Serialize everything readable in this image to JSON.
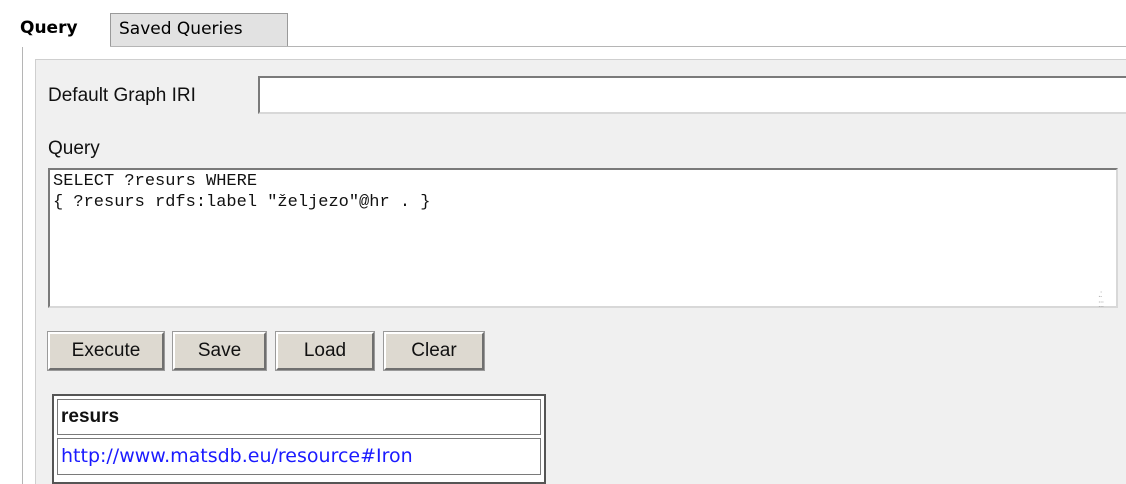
{
  "tabs": {
    "query_label": "Query",
    "saved_label": "Saved Queries"
  },
  "form": {
    "graph_label": "Default Graph IRI",
    "graph_value": "",
    "query_label": "Query",
    "query_text": "SELECT ?resurs WHERE\n{ ?resurs rdfs:label \"željezo\"@hr . }"
  },
  "buttons": {
    "execute": "Execute",
    "save": "Save",
    "load": "Load",
    "clear": "Clear"
  },
  "results": {
    "columns": [
      "resurs"
    ],
    "rows": [
      [
        "http://www.matsdb.eu/resource#Iron"
      ]
    ]
  },
  "colors": {
    "link": "#1a1aff",
    "button_face": "#ddd9d0",
    "panel_bg": "#f0f0f0"
  }
}
